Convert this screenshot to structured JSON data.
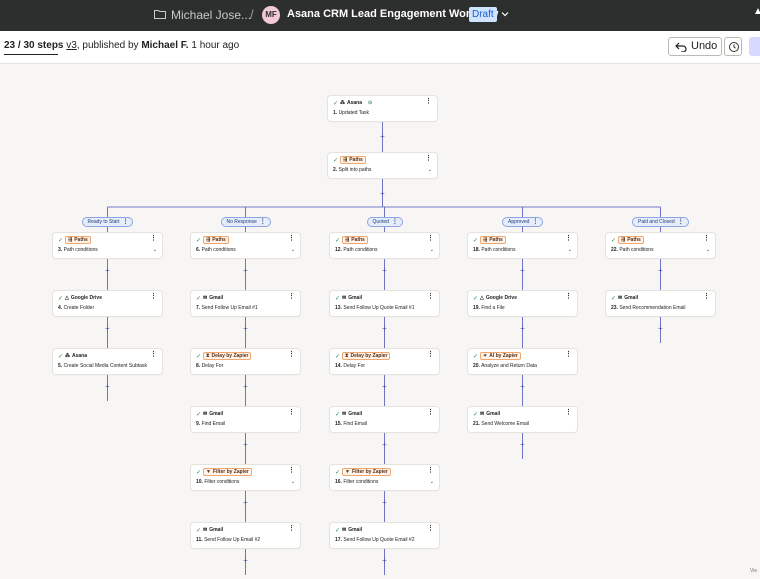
{
  "topbar": {
    "folder": "Michael Jose...",
    "sep": "/",
    "avatar": "MF",
    "title": "Asana CRM Lead Engagement Workflow",
    "status": "Draft",
    "edge_arrow": "▲"
  },
  "subbar": {
    "steps": "23 / 30 steps",
    "version": "v3",
    "published_by": ", published by",
    "author": "Michael F.",
    "time": "1 hour ago",
    "undo": "Undo"
  },
  "paths": [
    {
      "label": "Ready to Start"
    },
    {
      "label": "No Response"
    },
    {
      "label": "Quoted"
    },
    {
      "label": "Approved"
    },
    {
      "label": "Paid and Closed"
    }
  ],
  "steps": [
    {
      "app": "Asana",
      "icon": "asana-icon",
      "num": "1.",
      "title": "Updated Task",
      "boxed": false,
      "caret": false,
      "status": true
    },
    {
      "app": "Paths",
      "icon": "paths-icon",
      "num": "2.",
      "title": "Split into paths",
      "boxed": true,
      "caret": true
    },
    {
      "app": "Paths",
      "icon": "paths-icon",
      "num": "3.",
      "title": "Path conditions",
      "boxed": true,
      "caret": true
    },
    {
      "app": "Google Drive",
      "icon": "google-drive-icon",
      "num": "4.",
      "title": "Create Folder",
      "boxed": false,
      "caret": false
    },
    {
      "app": "Asana",
      "icon": "asana-icon",
      "num": "5.",
      "title": "Create Social Media Content Subtask",
      "boxed": false,
      "caret": false
    },
    {
      "app": "Paths",
      "icon": "paths-icon",
      "num": "6.",
      "title": "Path conditions",
      "boxed": true,
      "caret": true
    },
    {
      "app": "Gmail",
      "icon": "gmail-icon",
      "num": "7.",
      "title": "Send Follow Up Email #1",
      "boxed": false,
      "caret": false
    },
    {
      "app": "Delay by Zapier",
      "icon": "delay-icon",
      "num": "8.",
      "title": "Delay For",
      "boxed": true,
      "caret": false
    },
    {
      "app": "Gmail",
      "icon": "gmail-icon",
      "num": "9.",
      "title": "Find Email",
      "boxed": false,
      "caret": false
    },
    {
      "app": "Filter by Zapier",
      "icon": "filter-icon",
      "num": "10.",
      "title": "Filter conditions",
      "boxed": true,
      "caret": true
    },
    {
      "app": "Gmail",
      "icon": "gmail-icon",
      "num": "11.",
      "title": "Send Follow Up Email #2",
      "boxed": false,
      "caret": false
    },
    {
      "app": "Paths",
      "icon": "paths-icon",
      "num": "12.",
      "title": "Path conditions",
      "boxed": true,
      "caret": true
    },
    {
      "app": "Gmail",
      "icon": "gmail-icon",
      "num": "13.",
      "title": "Send Follow Up Quote Email #1",
      "boxed": false,
      "caret": false
    },
    {
      "app": "Delay by Zapier",
      "icon": "delay-icon",
      "num": "14.",
      "title": "Delay For",
      "boxed": true,
      "caret": false
    },
    {
      "app": "Gmail",
      "icon": "gmail-icon",
      "num": "15.",
      "title": "Find Email",
      "boxed": false,
      "caret": false
    },
    {
      "app": "Filter by Zapier",
      "icon": "filter-icon",
      "num": "16.",
      "title": "Filter conditions",
      "boxed": true,
      "caret": true
    },
    {
      "app": "Gmail",
      "icon": "gmail-icon",
      "num": "17.",
      "title": "Send Follow Up Quote Email #2",
      "boxed": false,
      "caret": false
    },
    {
      "app": "Paths",
      "icon": "paths-icon",
      "num": "18.",
      "title": "Path conditions",
      "boxed": true,
      "caret": true
    },
    {
      "app": "Google Drive",
      "icon": "google-drive-icon",
      "num": "19.",
      "title": "Find a File",
      "boxed": false,
      "caret": false
    },
    {
      "app": "AI by Zapier",
      "icon": "ai-icon",
      "num": "20.",
      "title": "Analyze and Return Data",
      "boxed": true,
      "caret": false
    },
    {
      "app": "Gmail",
      "icon": "gmail-icon",
      "num": "21.",
      "title": "Send Welcome Email",
      "boxed": false,
      "caret": false
    },
    {
      "app": "Paths",
      "icon": "paths-icon",
      "num": "22.",
      "title": "Path conditions",
      "boxed": true,
      "caret": true
    },
    {
      "app": "Gmail",
      "icon": "gmail-icon",
      "num": "23.",
      "title": "Send Recommendation Email",
      "boxed": false,
      "caret": false
    }
  ],
  "corner_text": "Vie",
  "colors": {
    "accent": "#4a55b8",
    "path_fill": "#e6edfb",
    "app_box": "#f0a76f",
    "topbar": "#2d2e2e"
  }
}
